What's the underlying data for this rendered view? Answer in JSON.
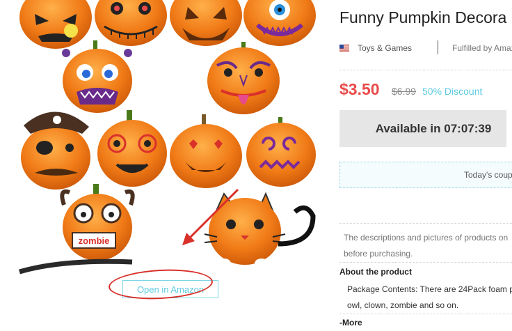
{
  "product": {
    "title": "Funny Pumpkin Decora",
    "flag_icon": "us-flag-icon",
    "category": "Toys & Games",
    "fulfillment": "Fulfilled by Amazon",
    "price": "$3.50",
    "original_price": "$6.99",
    "discount": "50% Discount",
    "availability": "Available in 07:07:39",
    "coupon_text": "Today's coup",
    "description_line1": "The descriptions and pictures of products on",
    "description_line2": "before purchasing.",
    "about_heading": "About the product",
    "package_line1": "Package Contents: There are 24Pack foam p",
    "package_line2": "owl, clown, zombie and so on.",
    "more_link": "-More"
  },
  "image_panel": {
    "open_link": "Open in Amazon",
    "zombie_sign": "zombie"
  },
  "colors": {
    "pumpkin": "#f07a16",
    "price_red": "#e84b4b",
    "accent_teal": "#5ecbe0",
    "annotation_red": "#d9302a"
  }
}
